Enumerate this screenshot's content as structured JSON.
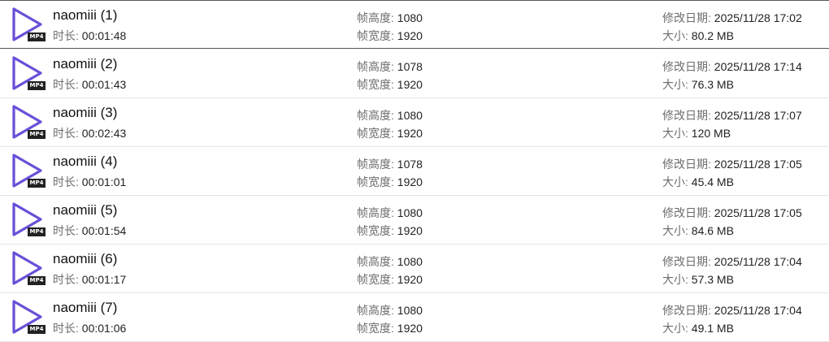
{
  "labels": {
    "duration": "时长: ",
    "frame_height": "帧高度: ",
    "frame_width": "帧宽度: ",
    "modified": "修改日期: ",
    "size": "大小: "
  },
  "colors": {
    "play_icon": "#6a4fd8",
    "badge_bg": "#222222",
    "badge_text": "#ffffff"
  },
  "icon": {
    "name": "play-video-icon",
    "badge": "MP4"
  },
  "files": [
    {
      "name": "naomiii (1)",
      "duration": "00:01:48",
      "height": "1080",
      "width": "1920",
      "modified": "2025/11/28 17:02",
      "size": "80.2 MB"
    },
    {
      "name": "naomiii (2)",
      "duration": "00:01:43",
      "height": "1078",
      "width": "1920",
      "modified": "2025/11/28 17:14",
      "size": "76.3 MB"
    },
    {
      "name": "naomiii (3)",
      "duration": "00:02:43",
      "height": "1080",
      "width": "1920",
      "modified": "2025/11/28 17:07",
      "size": "120 MB"
    },
    {
      "name": "naomiii (4)",
      "duration": "00:01:01",
      "height": "1078",
      "width": "1920",
      "modified": "2025/11/28 17:05",
      "size": "45.4 MB"
    },
    {
      "name": "naomiii (5)",
      "duration": "00:01:54",
      "height": "1080",
      "width": "1920",
      "modified": "2025/11/28 17:05",
      "size": "84.6 MB"
    },
    {
      "name": "naomiii (6)",
      "duration": "00:01:17",
      "height": "1080",
      "width": "1920",
      "modified": "2025/11/28 17:04",
      "size": "57.3 MB"
    },
    {
      "name": "naomiii (7)",
      "duration": "00:01:06",
      "height": "1080",
      "width": "1920",
      "modified": "2025/11/28 17:04",
      "size": "49.1 MB"
    }
  ]
}
